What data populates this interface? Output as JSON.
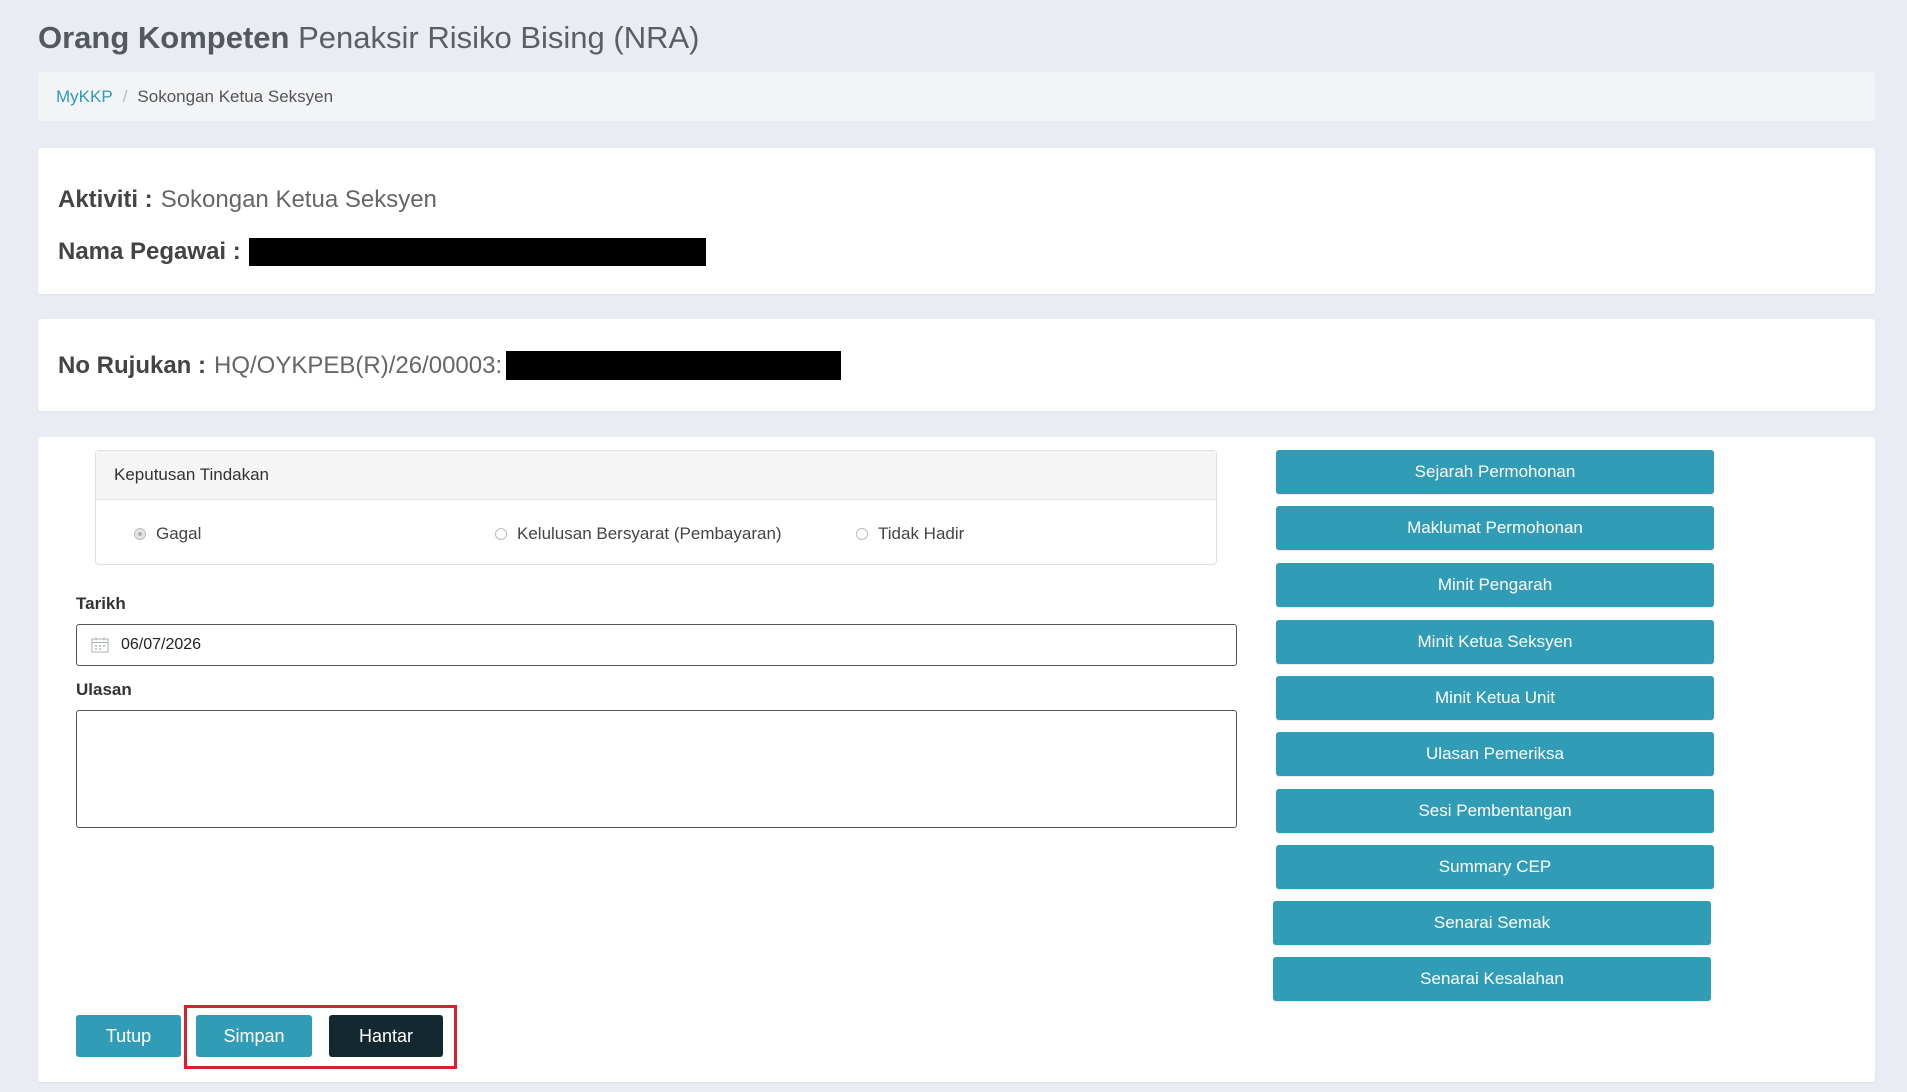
{
  "header": {
    "title_bold": "Orang Kompeten",
    "title_rest": "Penaksir Risiko Bising (NRA)"
  },
  "breadcrumb": {
    "home": "MyKKP",
    "separator": "/",
    "current": "Sokongan Ketua Seksyen"
  },
  "info": {
    "activity_label": "Aktiviti :",
    "activity_value": "Sokongan Ketua Seksyen",
    "employee_label": "Nama Pegawai :"
  },
  "reference": {
    "label": "No Rujukan :",
    "value": "HQ/OYKPEB(R)/26/00003:"
  },
  "decision": {
    "title": "Keputusan Tindakan",
    "options": [
      {
        "label": "Gagal",
        "selected": true
      },
      {
        "label": "Kelulusan Bersyarat (Pembayaran)",
        "selected": false
      },
      {
        "label": "Tidak Hadir",
        "selected": false
      }
    ]
  },
  "form": {
    "date_label": "Tarikh",
    "date_value": "06/07/2026",
    "comment_label": "Ulasan",
    "comment_value": ""
  },
  "side_buttons": [
    "Sejarah Permohonan",
    "Maklumat Permohonan",
    "Minit Pengarah",
    "Minit Ketua Seksyen",
    "Minit Ketua Unit",
    "Ulasan Pemeriksa",
    "Sesi Pembentangan",
    "Summary CEP",
    "Senarai Semak",
    "Senarai Kesalahan"
  ],
  "actions": {
    "close": "Tutup",
    "save": "Simpan",
    "submit": "Hantar"
  },
  "colors": {
    "accent": "#319cb5",
    "submit": "#13282f",
    "highlight": "#d6232b",
    "background": "#e9ecf3"
  },
  "icons": {
    "date_field": "calendar-icon"
  }
}
